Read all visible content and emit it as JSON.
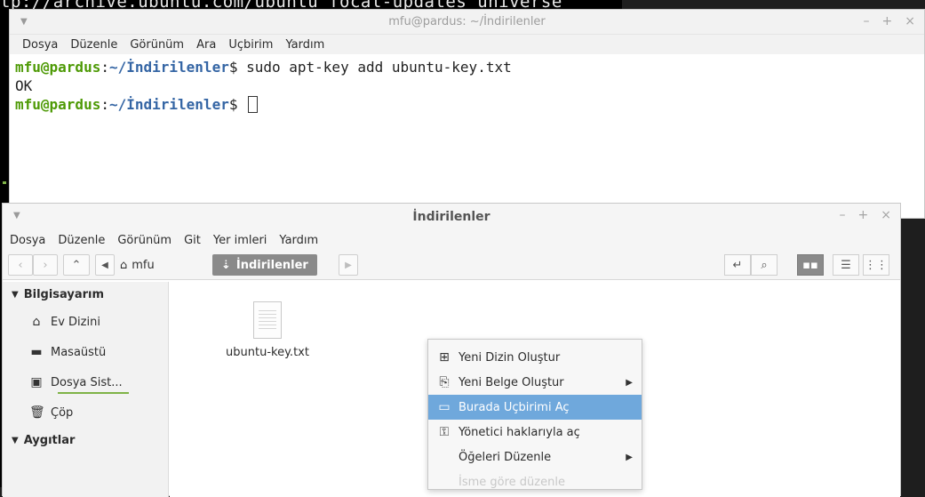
{
  "background_terminal": {
    "text": "tp://archive.ubuntu.com/ubuntu focal-updates universe"
  },
  "terminal": {
    "title": "mfu@pardus: ~/İndirilenler",
    "menu": [
      "Dosya",
      "Düzenle",
      "Görünüm",
      "Ara",
      "Uçbirim",
      "Yardım"
    ],
    "lines": [
      {
        "user": "mfu@pardus",
        "sep": ":",
        "path": "~/İndirilenler",
        "prompt": "$",
        "cmd": " sudo apt-key add ubuntu-key.txt"
      },
      {
        "output": "OK"
      },
      {
        "user": "mfu@pardus",
        "sep": ":",
        "path": "~/İndirilenler",
        "prompt": "$",
        "cmd": " "
      }
    ],
    "controls": {
      "minimize": "–",
      "maximize": "+",
      "close": "×"
    }
  },
  "file_manager": {
    "title": "İndirilenler",
    "menu": [
      "Dosya",
      "Düzenle",
      "Görünüm",
      "Git",
      "Yer imleri",
      "Yardım"
    ],
    "controls": {
      "minimize": "–",
      "maximize": "+",
      "close": "×"
    },
    "breadcrumb": {
      "home": "mfu",
      "current": "İndirilenler"
    },
    "sidebar": {
      "computer_header": "Bilgisayarım",
      "items": [
        "Ev Dizini",
        "Masaüstü",
        "Dosya Sist...",
        "Çöp"
      ],
      "devices_header": "Aygıtlar"
    },
    "files": [
      {
        "name": "ubuntu-key.txt"
      }
    ]
  },
  "context_menu": {
    "items": [
      {
        "label": "Yeni Dizin Oluştur",
        "icon": "new-folder-icon"
      },
      {
        "label": "Yeni Belge Oluştur",
        "icon": "new-document-icon",
        "submenu": true
      },
      {
        "label": "Burada Uçbirimi Aç",
        "icon": "terminal-icon",
        "highlighted": true
      },
      {
        "label": "Yönetici haklarıyla aç",
        "icon": "key-icon"
      },
      {
        "label": "Öğeleri Düzenle",
        "submenu": true
      },
      {
        "label": "İsme göre düzenle"
      }
    ]
  }
}
